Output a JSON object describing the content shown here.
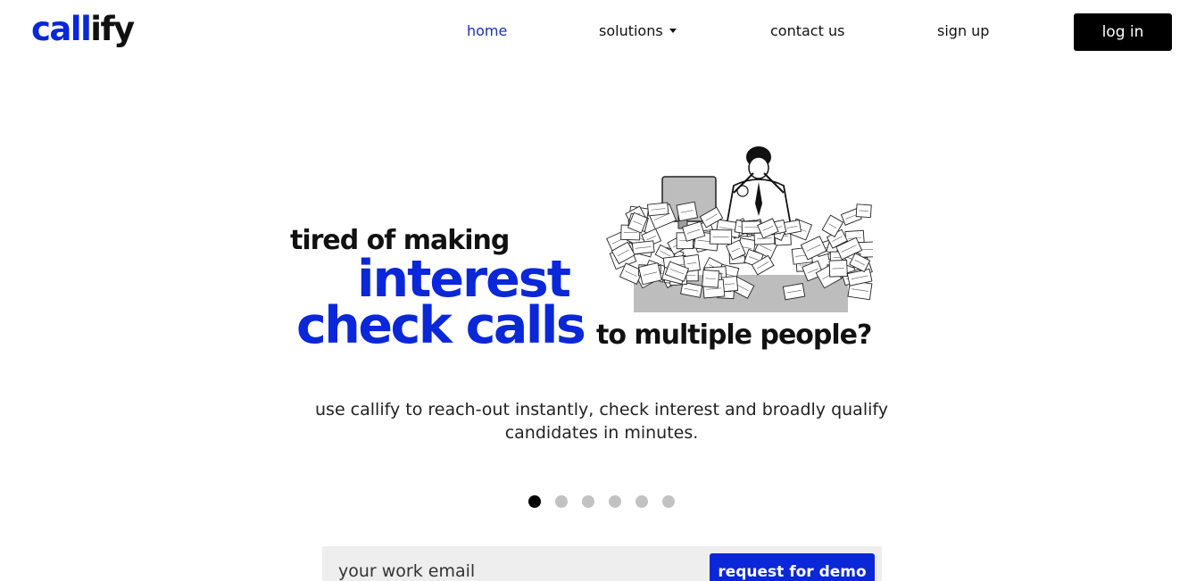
{
  "header": {
    "logo": {
      "part_blue": "call",
      "part_dark": "ify",
      "accent": "#0a27d8"
    },
    "nav": {
      "home": "home",
      "solutions": "solutions",
      "contact": "contact us",
      "signup": "sign up"
    },
    "login_label": "log in"
  },
  "hero": {
    "line1": "tired of making",
    "line2": "interest",
    "line3": "check calls",
    "line4": "to multiple people?",
    "subtext": "use callify to reach-out instantly, check interest and broadly qualify candidates in minutes.",
    "illustration_icon": "overwhelmed-man-paperwork-illustration"
  },
  "carousel": {
    "slide_count": 6,
    "active_index": 0
  },
  "cta": {
    "email_placeholder": "your work email",
    "button_label": "request for demo"
  },
  "colors": {
    "brand_blue": "#0a27d8",
    "nav_active": "#1b2fb8",
    "dot_inactive": "#c2c2c2"
  }
}
